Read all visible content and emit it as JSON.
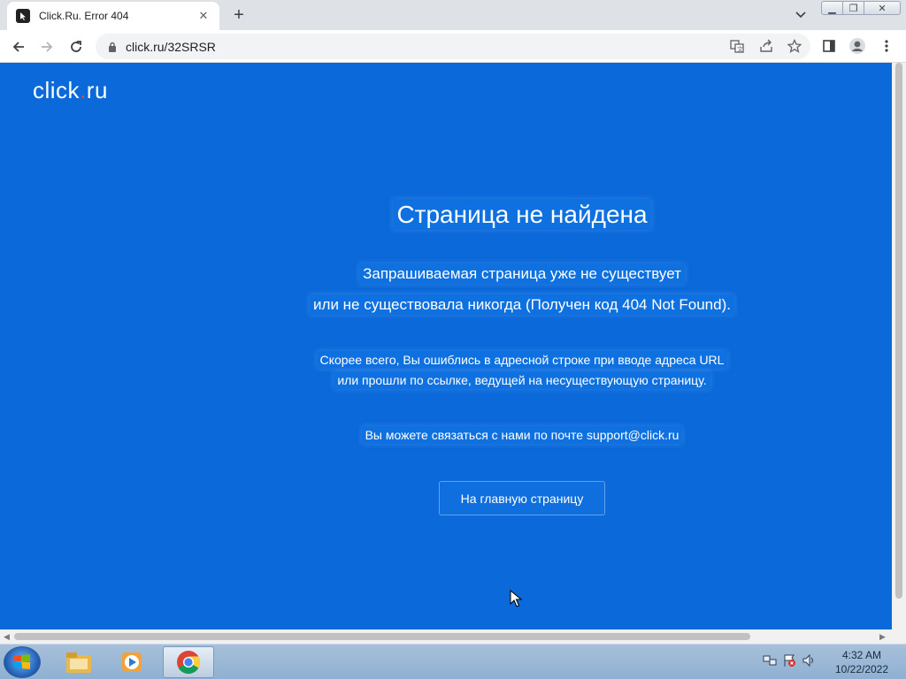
{
  "browser": {
    "tab_title": "Click.Ru. Error 404",
    "url": "click.ru/32SRSR"
  },
  "page": {
    "logo_main": "click",
    "logo_dot": ".",
    "logo_tld": "ru",
    "title": "Страница не найдена",
    "line1": "Запрашиваемая страница уже не существует",
    "line2": "или не существовала никогда (Получен код 404 Not Found).",
    "line3": "Скорее всего, Вы ошиблись в адресной строке при вводе адреса URL",
    "line4": "или прошли по ссылке, ведущей на несуществующую страницу.",
    "contact": "Вы можете связаться с нами по почте support@click.ru",
    "home_button": "На главную страницу",
    "background_color": "#0b69d9"
  },
  "taskbar": {
    "time": "4:32 AM",
    "date": "10/22/2022",
    "apps": [
      "explorer-icon",
      "media-player-icon",
      "chrome-icon"
    ]
  }
}
